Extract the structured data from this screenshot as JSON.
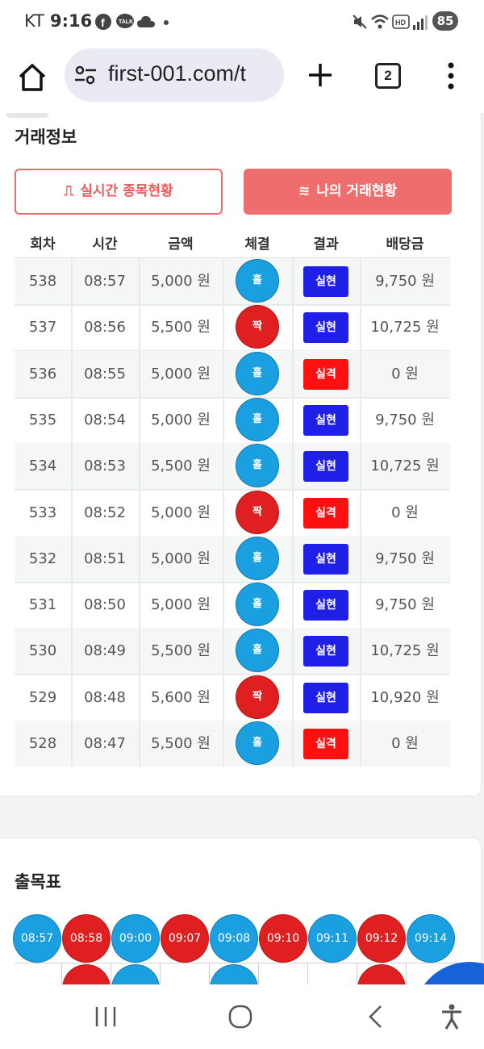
{
  "status_bar": {
    "carrier": "KT",
    "time": "9:16",
    "battery": "85",
    "icons": [
      "facebook-icon",
      "talk-icon",
      "cloud-icon",
      "dot-icon",
      "mute-icon",
      "wifi-icon",
      "hd-icon",
      "signal-icon"
    ]
  },
  "browser": {
    "url": "first-001.com/t",
    "tab_count": "2",
    "icons": [
      "home-icon",
      "site-settings-icon",
      "plus-icon",
      "menu-icon"
    ]
  },
  "trade_section": {
    "title": "거래정보",
    "btn_live": "실시간 종목현황",
    "btn_mine": "나의 거래현황",
    "columns": [
      "회차",
      "시간",
      "금액",
      "체결",
      "결과",
      "배당금"
    ],
    "rows": [
      {
        "round": "538",
        "time": "08:57",
        "amount": "5,000 원",
        "type": "홀",
        "result": "실현",
        "payout": "9,750 원"
      },
      {
        "round": "537",
        "time": "08:56",
        "amount": "5,500 원",
        "type": "짝",
        "result": "실현",
        "payout": "10,725 원"
      },
      {
        "round": "536",
        "time": "08:55",
        "amount": "5,000 원",
        "type": "홀",
        "result": "실격",
        "payout": "0 원"
      },
      {
        "round": "535",
        "time": "08:54",
        "amount": "5,000 원",
        "type": "홀",
        "result": "실현",
        "payout": "9,750 원"
      },
      {
        "round": "534",
        "time": "08:53",
        "amount": "5,500 원",
        "type": "홀",
        "result": "실현",
        "payout": "10,725 원"
      },
      {
        "round": "533",
        "time": "08:52",
        "amount": "5,000 원",
        "type": "짝",
        "result": "실격",
        "payout": "0 원"
      },
      {
        "round": "532",
        "time": "08:51",
        "amount": "5,000 원",
        "type": "홀",
        "result": "실현",
        "payout": "9,750 원"
      },
      {
        "round": "531",
        "time": "08:50",
        "amount": "5,000 원",
        "type": "홀",
        "result": "실현",
        "payout": "9,750 원"
      },
      {
        "round": "530",
        "time": "08:49",
        "amount": "5,500 원",
        "type": "홀",
        "result": "실현",
        "payout": "10,725 원"
      },
      {
        "round": "529",
        "time": "08:48",
        "amount": "5,600 원",
        "type": "짝",
        "result": "실현",
        "payout": "10,920 원"
      },
      {
        "round": "528",
        "time": "08:47",
        "amount": "5,500 원",
        "type": "홀",
        "result": "실격",
        "payout": "0 원"
      }
    ],
    "colors": {
      "hol": "#1a9fe0",
      "jjak": "#e02020",
      "success": "#1f1fe8",
      "fail": "#ff1010"
    }
  },
  "chart_section": {
    "title": "출목표",
    "balls": [
      {
        "label": "08:57",
        "type": "홀"
      },
      {
        "label": "08:58",
        "type": "짝"
      },
      {
        "label": "09:00",
        "type": "홀"
      },
      {
        "label": "09:07",
        "type": "짝"
      },
      {
        "label": "09:08",
        "type": "홀"
      },
      {
        "label": "09:10",
        "type": "짝"
      },
      {
        "label": "09:11",
        "type": "홀"
      },
      {
        "label": "09:12",
        "type": "짝"
      },
      {
        "label": "09:14",
        "type": "홀"
      }
    ],
    "second_row_types": [
      "짝",
      "홀",
      "",
      "홀",
      "",
      "",
      "짝",
      ""
    ]
  },
  "nav_bar": {
    "icons": [
      "recents-icon",
      "home-circle-icon",
      "back-icon",
      "accessibility-icon"
    ]
  }
}
